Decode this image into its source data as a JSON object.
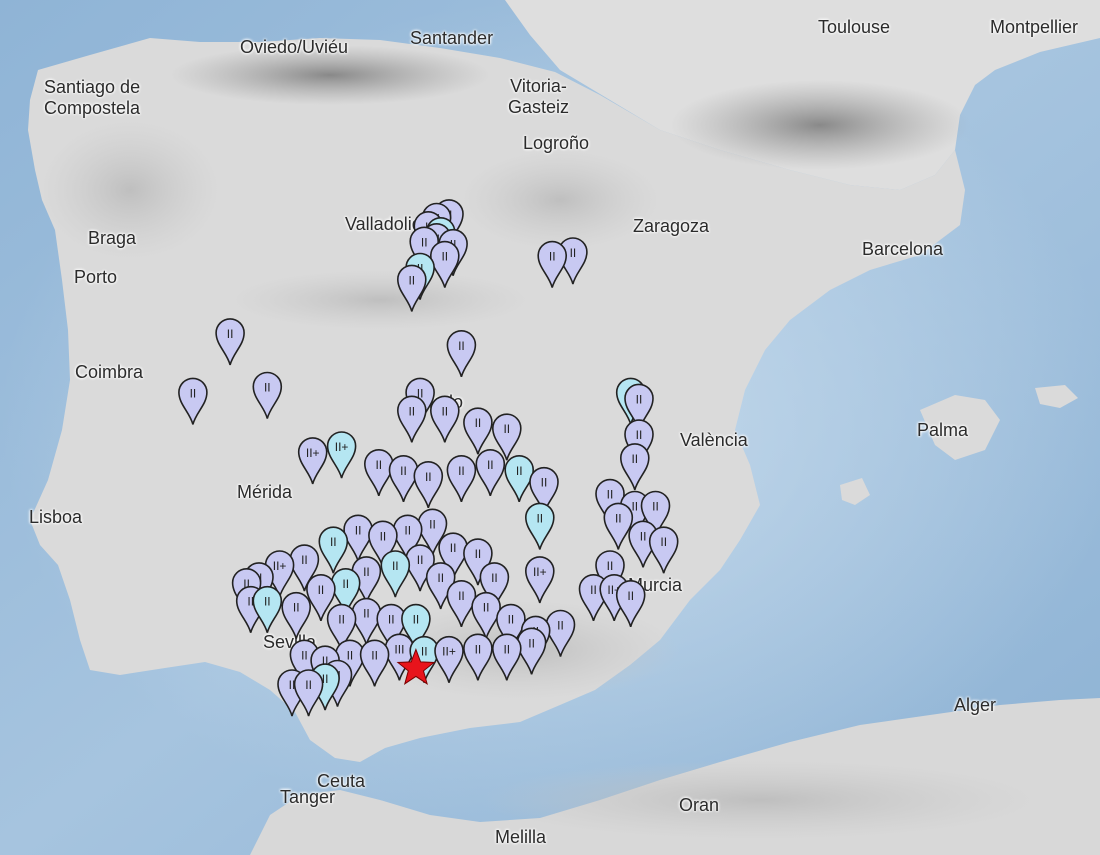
{
  "map": {
    "colors": {
      "sea_deep": "#7fa9cf",
      "sea": "#a9c6de",
      "sea_shallow": "#c9dced",
      "land": "#dcdcdc",
      "land_light": "#ececec",
      "mountains": "#8e8e8e",
      "marker_fill": "#c8c9f2",
      "marker_fill_alt": "#b5e6f2",
      "marker_stroke": "#222222",
      "epicenter": "#e8141c"
    },
    "epicenter": {
      "label": "epicenter-star"
    },
    "cities": {
      "toulouse": "Toulouse",
      "montpellier": "Montpellier",
      "oviedo": "Oviedo/Uviéu",
      "santander": "Santander",
      "santiago_1": "Santiago de",
      "santiago_2": "Compostela",
      "vitoria_1": "Vitoria-",
      "vitoria_2": "Gasteiz",
      "logrono": "Logroño",
      "valladolid": "Valladolid",
      "zaragoza": "Zaragoza",
      "braga": "Braga",
      "barcelona": "Barcelona",
      "porto": "Porto",
      "coimbra": "Coimbra",
      "toledo": "Toledo",
      "valencia": "València",
      "palma": "Palma",
      "merida": "Mérida",
      "lisboa": "Lisboa",
      "murcia": "Murcia",
      "sevilla": "Sevilla",
      "algeria_city": "Alger",
      "ceuta": "Ceuta",
      "tanger": "Tanger",
      "oran": "Oran",
      "melilla": "Melilla"
    },
    "intensity_reports": [
      {
        "lon": -3.7,
        "lat": 40.42,
        "intensity": "II"
      },
      {
        "lon": -3.55,
        "lat": 40.45,
        "intensity": "II"
      },
      {
        "lon": -3.8,
        "lat": 40.35,
        "intensity": "II"
      },
      {
        "lon": -3.65,
        "lat": 40.3,
        "intensity": "II"
      },
      {
        "lon": -3.5,
        "lat": 40.2,
        "intensity": "II"
      },
      {
        "lon": -3.9,
        "lat": 40.0,
        "intensity": "II"
      },
      {
        "lon": -4.0,
        "lat": 39.9,
        "intensity": "II"
      },
      {
        "lon": -3.6,
        "lat": 40.1,
        "intensity": "II"
      },
      {
        "lon": -3.7,
        "lat": 40.25,
        "intensity": "II"
      },
      {
        "lon": -3.85,
        "lat": 40.22,
        "intensity": "II"
      },
      {
        "lon": -2.3,
        "lat": 40.1,
        "intensity": "II"
      },
      {
        "lon": -2.05,
        "lat": 40.13,
        "intensity": "II"
      },
      {
        "lon": -3.4,
        "lat": 39.35,
        "intensity": "II"
      },
      {
        "lon": -6.2,
        "lat": 39.45,
        "intensity": "II"
      },
      {
        "lon": -6.65,
        "lat": 38.95,
        "intensity": "II"
      },
      {
        "lon": -5.75,
        "lat": 39.0,
        "intensity": "II"
      },
      {
        "lon": -3.9,
        "lat": 38.95,
        "intensity": "II"
      },
      {
        "lon": -4.0,
        "lat": 38.8,
        "intensity": "II"
      },
      {
        "lon": -3.6,
        "lat": 38.8,
        "intensity": "II"
      },
      {
        "lon": -3.2,
        "lat": 38.7,
        "intensity": "II"
      },
      {
        "lon": -2.85,
        "lat": 38.65,
        "intensity": "II"
      },
      {
        "lon": -1.35,
        "lat": 38.95,
        "intensity": "II"
      },
      {
        "lon": -1.25,
        "lat": 38.9,
        "intensity": "II"
      },
      {
        "lon": -1.25,
        "lat": 38.6,
        "intensity": "II"
      },
      {
        "lon": -1.3,
        "lat": 38.4,
        "intensity": "II"
      },
      {
        "lon": -5.2,
        "lat": 38.45,
        "intensity": "II+"
      },
      {
        "lon": -4.85,
        "lat": 38.5,
        "intensity": "II+"
      },
      {
        "lon": -4.4,
        "lat": 38.35,
        "intensity": "II"
      },
      {
        "lon": -4.1,
        "lat": 38.3,
        "intensity": "II"
      },
      {
        "lon": -3.8,
        "lat": 38.25,
        "intensity": "II"
      },
      {
        "lon": -3.4,
        "lat": 38.3,
        "intensity": "II"
      },
      {
        "lon": -3.05,
        "lat": 38.35,
        "intensity": "II"
      },
      {
        "lon": -2.7,
        "lat": 38.3,
        "intensity": "II"
      },
      {
        "lon": -2.4,
        "lat": 38.2,
        "intensity": "II"
      },
      {
        "lon": -1.6,
        "lat": 38.1,
        "intensity": "II"
      },
      {
        "lon": -1.3,
        "lat": 38.0,
        "intensity": "II"
      },
      {
        "lon": -1.05,
        "lat": 38.0,
        "intensity": "II"
      },
      {
        "lon": -1.5,
        "lat": 37.9,
        "intensity": "II"
      },
      {
        "lon": -1.2,
        "lat": 37.75,
        "intensity": "II"
      },
      {
        "lon": -0.95,
        "lat": 37.7,
        "intensity": "II"
      },
      {
        "lon": -1.6,
        "lat": 37.5,
        "intensity": "II"
      },
      {
        "lon": -1.8,
        "lat": 37.3,
        "intensity": "II"
      },
      {
        "lon": -1.55,
        "lat": 37.3,
        "intensity": "II+"
      },
      {
        "lon": -1.35,
        "lat": 37.25,
        "intensity": "II"
      },
      {
        "lon": -2.45,
        "lat": 37.9,
        "intensity": "II"
      },
      {
        "lon": -2.45,
        "lat": 37.45,
        "intensity": "II+"
      },
      {
        "lon": -3.0,
        "lat": 37.4,
        "intensity": "II"
      },
      {
        "lon": -3.2,
        "lat": 37.6,
        "intensity": "II"
      },
      {
        "lon": -3.5,
        "lat": 37.65,
        "intensity": "II"
      },
      {
        "lon": -3.75,
        "lat": 37.85,
        "intensity": "II"
      },
      {
        "lon": -4.05,
        "lat": 37.8,
        "intensity": "II"
      },
      {
        "lon": -4.35,
        "lat": 37.75,
        "intensity": "II"
      },
      {
        "lon": -4.65,
        "lat": 37.8,
        "intensity": "II"
      },
      {
        "lon": -4.95,
        "lat": 37.7,
        "intensity": "II"
      },
      {
        "lon": -5.3,
        "lat": 37.55,
        "intensity": "II"
      },
      {
        "lon": -5.6,
        "lat": 37.5,
        "intensity": "II+"
      },
      {
        "lon": -5.85,
        "lat": 37.4,
        "intensity": "II"
      },
      {
        "lon": -6.0,
        "lat": 37.35,
        "intensity": "II"
      },
      {
        "lon": -5.95,
        "lat": 37.2,
        "intensity": "II"
      },
      {
        "lon": -5.75,
        "lat": 37.2,
        "intensity": "II"
      },
      {
        "lon": -5.4,
        "lat": 37.15,
        "intensity": "II"
      },
      {
        "lon": -5.1,
        "lat": 37.3,
        "intensity": "II"
      },
      {
        "lon": -4.8,
        "lat": 37.35,
        "intensity": "II"
      },
      {
        "lon": -4.55,
        "lat": 37.45,
        "intensity": "II"
      },
      {
        "lon": -4.2,
        "lat": 37.5,
        "intensity": "II"
      },
      {
        "lon": -3.9,
        "lat": 37.55,
        "intensity": "II"
      },
      {
        "lon": -3.65,
        "lat": 37.4,
        "intensity": "II"
      },
      {
        "lon": -3.4,
        "lat": 37.25,
        "intensity": "II"
      },
      {
        "lon": -3.1,
        "lat": 37.15,
        "intensity": "II"
      },
      {
        "lon": -2.8,
        "lat": 37.05,
        "intensity": "II"
      },
      {
        "lon": -2.5,
        "lat": 36.95,
        "intensity": "II"
      },
      {
        "lon": -2.2,
        "lat": 37.0,
        "intensity": "II"
      },
      {
        "lon": -4.85,
        "lat": 37.05,
        "intensity": "II"
      },
      {
        "lon": -4.55,
        "lat": 37.1,
        "intensity": "II"
      },
      {
        "lon": -4.25,
        "lat": 37.05,
        "intensity": "II"
      },
      {
        "lon": -3.95,
        "lat": 37.05,
        "intensity": "II"
      },
      {
        "lon": -5.3,
        "lat": 36.75,
        "intensity": "II"
      },
      {
        "lon": -5.05,
        "lat": 36.7,
        "intensity": "II"
      },
      {
        "lon": -4.75,
        "lat": 36.75,
        "intensity": "II"
      },
      {
        "lon": -4.45,
        "lat": 36.75,
        "intensity": "II"
      },
      {
        "lon": -4.15,
        "lat": 36.8,
        "intensity": "III"
      },
      {
        "lon": -3.85,
        "lat": 36.78,
        "intensity": "II"
      },
      {
        "lon": -3.55,
        "lat": 36.78,
        "intensity": "II+"
      },
      {
        "lon": -3.2,
        "lat": 36.8,
        "intensity": "II"
      },
      {
        "lon": -2.85,
        "lat": 36.8,
        "intensity": "II"
      },
      {
        "lon": -2.55,
        "lat": 36.85,
        "intensity": "II"
      },
      {
        "lon": -5.45,
        "lat": 36.5,
        "intensity": "II"
      },
      {
        "lon": -5.25,
        "lat": 36.5,
        "intensity": "II"
      },
      {
        "lon": -5.05,
        "lat": 36.55,
        "intensity": "II"
      },
      {
        "lon": -4.9,
        "lat": 36.58,
        "intensity": "II"
      }
    ]
  }
}
